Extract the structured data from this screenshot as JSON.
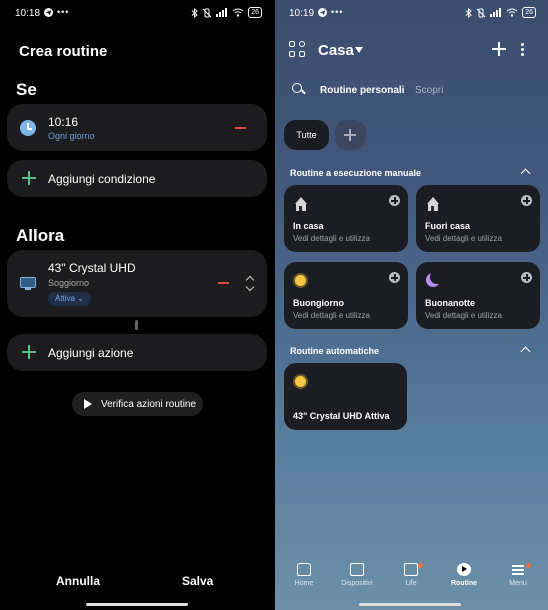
{
  "left": {
    "status_time": "10:18",
    "battery": "26",
    "title": "Crea routine",
    "section_if": "Se",
    "condition": {
      "time": "10:16",
      "repeat": "Ogni giorno"
    },
    "add_condition": "Aggiungi condizione",
    "section_then": "Allora",
    "action": {
      "device": "43\" Crystal UHD",
      "room": "Soggiorno",
      "state": "Attiva"
    },
    "add_action": "Aggiungi azione",
    "verify": "Verifica azioni routine",
    "cancel": "Annulla",
    "save": "Salva"
  },
  "right": {
    "status_time": "10:19",
    "battery": "26",
    "location": "Casa",
    "tabs": {
      "active": "Routine personali",
      "other": "Scopri"
    },
    "filter_all": "Tutte",
    "manual_title": "Routine a esecuzione manuale",
    "cards": [
      {
        "name": "In casa",
        "sub": "Vedi dettagli e utilizza",
        "icon": "home-icon"
      },
      {
        "name": "Fuori casa",
        "sub": "Vedi dettagli e utilizza",
        "icon": "house-icon"
      },
      {
        "name": "Buongiorno",
        "sub": "Vedi dettagli e utilizza",
        "icon": "sun-icon"
      },
      {
        "name": "Buonanotte",
        "sub": "Vedi dettagli e utilizza",
        "icon": "moon-icon"
      }
    ],
    "auto_title": "Routine automatiche",
    "auto_card": {
      "name": "43\" Crystal UHD Attiva",
      "icon": "sun-icon"
    },
    "nav": {
      "home": "Home",
      "devices": "Dispositivi",
      "life": "Life",
      "routine": "Routine",
      "menu": "Menu"
    }
  },
  "colors": {
    "accent_blue": "#6f9bd8",
    "plus_green": "#5fbf8a",
    "remove_red": "#e14a3a",
    "sun_yellow": "#f6c742",
    "moon_purple": "#b58cf0",
    "notification_dot": "#f07043"
  }
}
